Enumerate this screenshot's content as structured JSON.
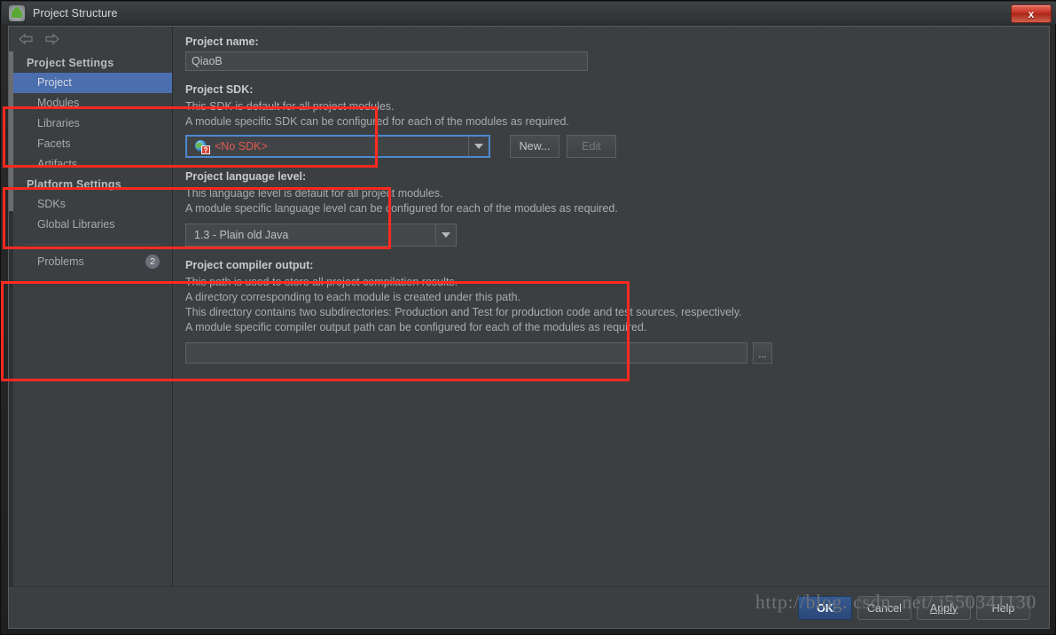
{
  "window": {
    "title": "Project Structure",
    "icon": "android-studio-icon",
    "close_label": "x"
  },
  "toolbar": {
    "back_icon": "arrow-left-icon",
    "forward_icon": "arrow-right-icon"
  },
  "sidebar": {
    "groups": [
      {
        "title": "Project Settings",
        "items": [
          {
            "label": "Project",
            "selected": true
          },
          {
            "label": "Modules",
            "selected": false
          },
          {
            "label": "Libraries",
            "selected": false
          },
          {
            "label": "Facets",
            "selected": false
          },
          {
            "label": "Artifacts",
            "selected": false
          }
        ]
      },
      {
        "title": "Platform Settings",
        "items": [
          {
            "label": "SDKs",
            "selected": false
          },
          {
            "label": "Global Libraries",
            "selected": false
          }
        ]
      }
    ],
    "problems": {
      "label": "Problems",
      "badge": "2"
    }
  },
  "main": {
    "project_name": {
      "label": "Project name:",
      "value": "QiaoB"
    },
    "project_sdk": {
      "label": "Project SDK:",
      "desc_line1": "This SDK is default for all project modules.",
      "desc_line2": "A module specific SDK can be configured for each of the modules as required.",
      "selected_value": "<No SDK>",
      "icon": "sdk-globe-question-icon",
      "new_button": "New...",
      "edit_button": "Edit"
    },
    "language_level": {
      "label": "Project language level:",
      "desc_line1": "This language level is default for all project modules.",
      "desc_line2": "A module specific language level can be configured for each of the modules as required.",
      "selected_value": "1.3 - Plain old Java"
    },
    "compiler_output": {
      "label": "Project compiler output:",
      "desc_line1": "This path is used to store all project compilation results.",
      "desc_line2": "A directory corresponding to each module is created under this path.",
      "desc_line3": "This directory contains two subdirectories: Production and Test for production code and test sources, respectively.",
      "desc_line4": "A module specific compiler output path can be configured for each of the modules as required.",
      "value": "",
      "placeholder": "",
      "browse_button": "..."
    }
  },
  "footer": {
    "ok": "OK",
    "cancel": "Cancel",
    "apply": "Apply",
    "help": "Help"
  },
  "watermark": {
    "text": "http://blog. csdn. net/ j550341130"
  },
  "colors": {
    "background": "#3c3f41",
    "selection": "#4b6eaf",
    "annotation": "#ff2a20",
    "error_text": "#e05c4e",
    "focus_border": "#4d88d0"
  }
}
